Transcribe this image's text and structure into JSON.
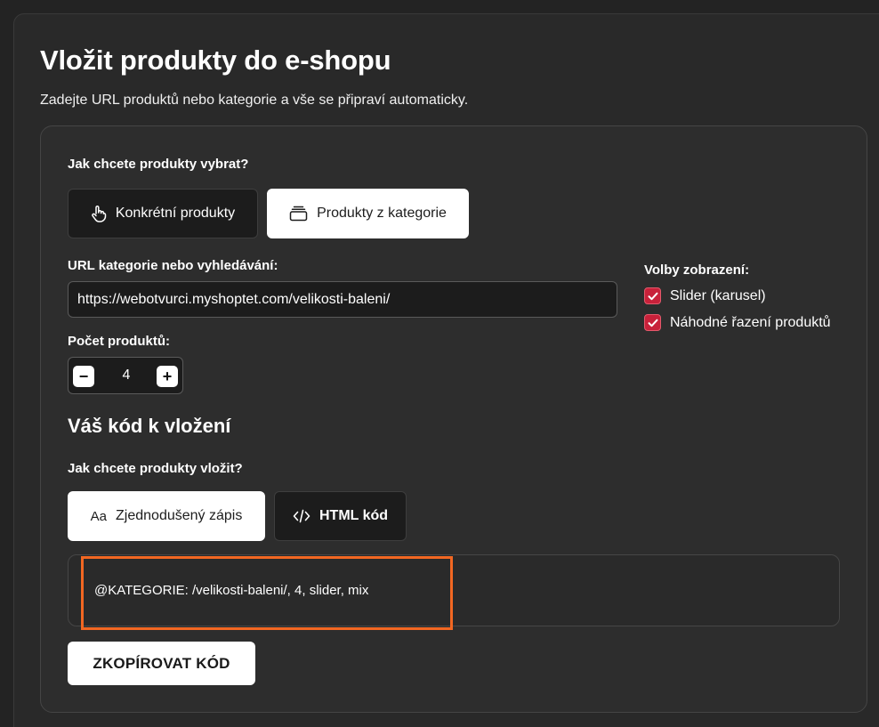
{
  "title": "Vložit produkty do e-shopu",
  "subtitle": "Zadejte URL produktů nebo kategorie a vše se připraví automaticky.",
  "selection": {
    "question": "Jak chcete produkty vybrat?",
    "options": [
      {
        "label": "Konkrétní produkty",
        "icon": "pointer-hand-icon",
        "selected": false
      },
      {
        "label": "Produkty z kategorie",
        "icon": "stack-icon",
        "selected": true
      }
    ]
  },
  "url_field": {
    "label": "URL kategorie nebo vyhledávání:",
    "value": "https://webotvurci.myshoptet.com/velikosti-baleni/"
  },
  "count": {
    "label": "Počet produktů:",
    "value": "4",
    "minus": "−",
    "plus": "+"
  },
  "display_options": {
    "label": "Volby zobrazení:",
    "items": [
      {
        "label": "Slider (karusel)",
        "checked": true
      },
      {
        "label": "Náhodné řazení produktů",
        "checked": true
      }
    ]
  },
  "code_section": {
    "title": "Váš kód k vložení",
    "question": "Jak chcete produkty vložit?",
    "formats": [
      {
        "icon_text": "Aa",
        "label": "Zjednodušený zápis",
        "selected": true
      },
      {
        "icon_text": "</>",
        "label": "HTML kód",
        "selected": false
      }
    ],
    "code": "@KATEGORIE: /velikosti-baleni/, 4, slider, mix",
    "copy_label": "ZKOPÍROVAT KÓD"
  },
  "colors": {
    "background": "#232323",
    "card": "#2d2d2d",
    "checkbox": "#c8213a",
    "highlight": "#f26722"
  }
}
